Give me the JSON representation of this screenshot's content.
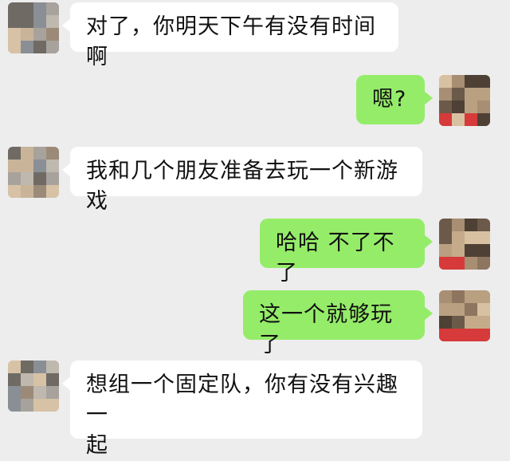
{
  "messages": [
    {
      "side": "in",
      "text": "对了，你明天下午有没有时间啊",
      "avatar": "contact-avatar-pixelated"
    },
    {
      "side": "out",
      "text": "嗯?",
      "avatar": "self-avatar-pixelated"
    },
    {
      "side": "in",
      "text": "我和几个朋友准备去玩一个新游戏",
      "avatar": "contact-avatar-pixelated"
    },
    {
      "side": "out",
      "text": "哈哈 不了不了",
      "avatar": "self-avatar-pixelated"
    },
    {
      "side": "out",
      "text": "这一个就够玩了",
      "avatar": "self-avatar-pixelated"
    },
    {
      "side": "in",
      "text": "想组一个固定队，你有没有兴趣一\n起",
      "avatar": "contact-avatar-pixelated"
    }
  ],
  "colors": {
    "background": "#ededed",
    "incoming_bubble": "#ffffff",
    "outgoing_bubble": "#95ec69",
    "text": "#111111"
  }
}
